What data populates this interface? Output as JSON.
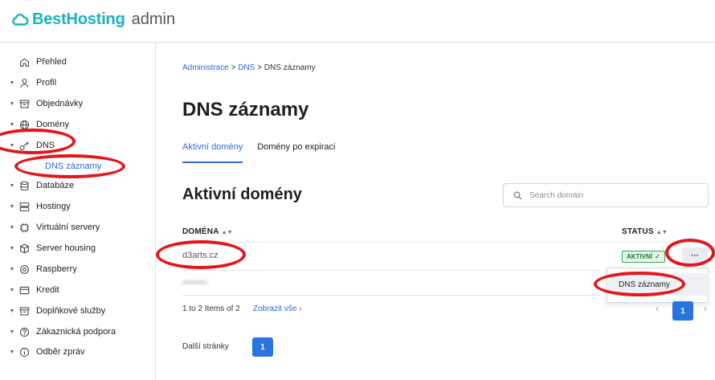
{
  "header": {
    "brand": "BestHosting",
    "suffix": "admin",
    "logo_icon": "cloud-logo-icon"
  },
  "sidebar": {
    "items": [
      {
        "label": "Přehled",
        "icon": "home-icon",
        "caret": false
      },
      {
        "label": "Profil",
        "icon": "user-icon",
        "caret": true
      },
      {
        "label": "Objednávky",
        "icon": "archive-icon",
        "caret": true
      },
      {
        "label": "Domény",
        "icon": "globe-icon",
        "caret": true
      },
      {
        "label": "DNS",
        "icon": "key-icon",
        "caret": true
      },
      {
        "label": "Databáze",
        "icon": "database-icon",
        "caret": true
      },
      {
        "label": "Hostingy",
        "icon": "server-icon",
        "caret": true
      },
      {
        "label": "Virtuální servery",
        "icon": "chip-icon",
        "caret": true
      },
      {
        "label": "Server housing",
        "icon": "box-icon",
        "caret": true
      },
      {
        "label": "Raspberry",
        "icon": "raspberry-icon",
        "caret": true
      },
      {
        "label": "Kredit",
        "icon": "card-icon",
        "caret": true
      },
      {
        "label": "Doplňkové služby",
        "icon": "archive-icon",
        "caret": true
      },
      {
        "label": "Zákaznická podpora",
        "icon": "help-icon",
        "caret": true
      },
      {
        "label": "Odběr zpráv",
        "icon": "info-icon",
        "caret": true
      }
    ],
    "sub_item": "DNS záznamy"
  },
  "breadcrumb": {
    "link1": "Administrace",
    "sep1": ">",
    "link2": "DNS",
    "sep2": ">",
    "current": "DNS záznamy"
  },
  "page_title": "DNS záznamy",
  "tabs": [
    {
      "label": "Aktivní domény",
      "active": true
    },
    {
      "label": "Domény po expiraci",
      "active": false
    }
  ],
  "section_title": "Aktivní domény",
  "search": {
    "placeholder": "Search domain",
    "value": ""
  },
  "table": {
    "columns": [
      "DOMÉNA",
      "STATUS"
    ],
    "rows": [
      {
        "domain": "d3arts.cz",
        "status": "AKTIVNÍ"
      },
      {
        "domain": "••••••••",
        "status": ""
      }
    ]
  },
  "row_menu": {
    "item": "DNS záznamy"
  },
  "pagination": {
    "summary": "1 to 2 Items of 2",
    "show_all": "Zobrazit vše",
    "current_page": "1"
  },
  "further_pages": {
    "label": "Další stránky",
    "page": "1"
  },
  "colors": {
    "brand": "#19b3c1",
    "link": "#2a6ad8",
    "primary": "#2a74e0",
    "highlight": "#e4151b",
    "success": "#2fa84f"
  }
}
